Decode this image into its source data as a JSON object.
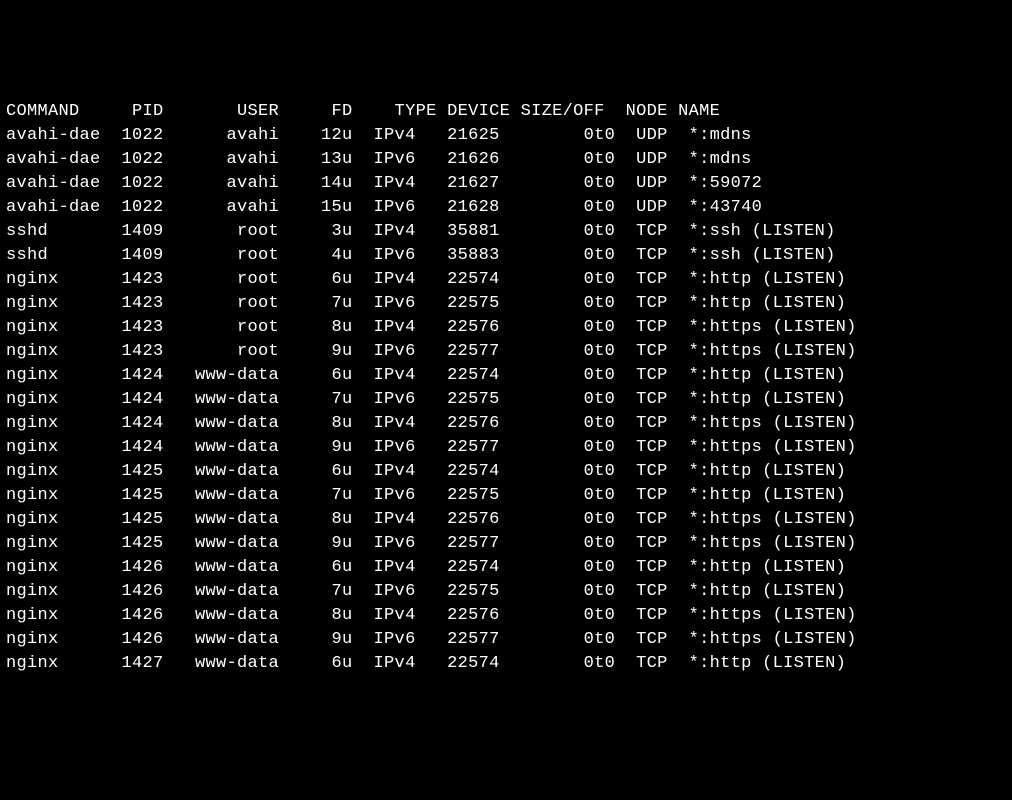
{
  "columns": {
    "command": "COMMAND",
    "pid": "PID",
    "user": "USER",
    "fd": "FD",
    "type": "TYPE",
    "device": "DEVICE",
    "sizeoff": "SIZE/OFF",
    "node": "NODE",
    "name": "NAME"
  },
  "rows": [
    {
      "command": "avahi-dae",
      "pid": "1022",
      "user": "avahi",
      "fd": "12u",
      "type": "IPv4",
      "device": "21625",
      "sizeoff": "0t0",
      "node": "UDP",
      "name": "*:mdns"
    },
    {
      "command": "avahi-dae",
      "pid": "1022",
      "user": "avahi",
      "fd": "13u",
      "type": "IPv6",
      "device": "21626",
      "sizeoff": "0t0",
      "node": "UDP",
      "name": "*:mdns"
    },
    {
      "command": "avahi-dae",
      "pid": "1022",
      "user": "avahi",
      "fd": "14u",
      "type": "IPv4",
      "device": "21627",
      "sizeoff": "0t0",
      "node": "UDP",
      "name": "*:59072"
    },
    {
      "command": "avahi-dae",
      "pid": "1022",
      "user": "avahi",
      "fd": "15u",
      "type": "IPv6",
      "device": "21628",
      "sizeoff": "0t0",
      "node": "UDP",
      "name": "*:43740"
    },
    {
      "command": "sshd",
      "pid": "1409",
      "user": "root",
      "fd": "3u",
      "type": "IPv4",
      "device": "35881",
      "sizeoff": "0t0",
      "node": "TCP",
      "name": "*:ssh (LISTEN)"
    },
    {
      "command": "sshd",
      "pid": "1409",
      "user": "root",
      "fd": "4u",
      "type": "IPv6",
      "device": "35883",
      "sizeoff": "0t0",
      "node": "TCP",
      "name": "*:ssh (LISTEN)"
    },
    {
      "command": "nginx",
      "pid": "1423",
      "user": "root",
      "fd": "6u",
      "type": "IPv4",
      "device": "22574",
      "sizeoff": "0t0",
      "node": "TCP",
      "name": "*:http (LISTEN)"
    },
    {
      "command": "nginx",
      "pid": "1423",
      "user": "root",
      "fd": "7u",
      "type": "IPv6",
      "device": "22575",
      "sizeoff": "0t0",
      "node": "TCP",
      "name": "*:http (LISTEN)"
    },
    {
      "command": "nginx",
      "pid": "1423",
      "user": "root",
      "fd": "8u",
      "type": "IPv4",
      "device": "22576",
      "sizeoff": "0t0",
      "node": "TCP",
      "name": "*:https (LISTEN)"
    },
    {
      "command": "nginx",
      "pid": "1423",
      "user": "root",
      "fd": "9u",
      "type": "IPv6",
      "device": "22577",
      "sizeoff": "0t0",
      "node": "TCP",
      "name": "*:https (LISTEN)"
    },
    {
      "command": "nginx",
      "pid": "1424",
      "user": "www-data",
      "fd": "6u",
      "type": "IPv4",
      "device": "22574",
      "sizeoff": "0t0",
      "node": "TCP",
      "name": "*:http (LISTEN)"
    },
    {
      "command": "nginx",
      "pid": "1424",
      "user": "www-data",
      "fd": "7u",
      "type": "IPv6",
      "device": "22575",
      "sizeoff": "0t0",
      "node": "TCP",
      "name": "*:http (LISTEN)"
    },
    {
      "command": "nginx",
      "pid": "1424",
      "user": "www-data",
      "fd": "8u",
      "type": "IPv4",
      "device": "22576",
      "sizeoff": "0t0",
      "node": "TCP",
      "name": "*:https (LISTEN)"
    },
    {
      "command": "nginx",
      "pid": "1424",
      "user": "www-data",
      "fd": "9u",
      "type": "IPv6",
      "device": "22577",
      "sizeoff": "0t0",
      "node": "TCP",
      "name": "*:https (LISTEN)"
    },
    {
      "command": "nginx",
      "pid": "1425",
      "user": "www-data",
      "fd": "6u",
      "type": "IPv4",
      "device": "22574",
      "sizeoff": "0t0",
      "node": "TCP",
      "name": "*:http (LISTEN)"
    },
    {
      "command": "nginx",
      "pid": "1425",
      "user": "www-data",
      "fd": "7u",
      "type": "IPv6",
      "device": "22575",
      "sizeoff": "0t0",
      "node": "TCP",
      "name": "*:http (LISTEN)"
    },
    {
      "command": "nginx",
      "pid": "1425",
      "user": "www-data",
      "fd": "8u",
      "type": "IPv4",
      "device": "22576",
      "sizeoff": "0t0",
      "node": "TCP",
      "name": "*:https (LISTEN)"
    },
    {
      "command": "nginx",
      "pid": "1425",
      "user": "www-data",
      "fd": "9u",
      "type": "IPv6",
      "device": "22577",
      "sizeoff": "0t0",
      "node": "TCP",
      "name": "*:https (LISTEN)"
    },
    {
      "command": "nginx",
      "pid": "1426",
      "user": "www-data",
      "fd": "6u",
      "type": "IPv4",
      "device": "22574",
      "sizeoff": "0t0",
      "node": "TCP",
      "name": "*:http (LISTEN)"
    },
    {
      "command": "nginx",
      "pid": "1426",
      "user": "www-data",
      "fd": "7u",
      "type": "IPv6",
      "device": "22575",
      "sizeoff": "0t0",
      "node": "TCP",
      "name": "*:http (LISTEN)"
    },
    {
      "command": "nginx",
      "pid": "1426",
      "user": "www-data",
      "fd": "8u",
      "type": "IPv4",
      "device": "22576",
      "sizeoff": "0t0",
      "node": "TCP",
      "name": "*:https (LISTEN)"
    },
    {
      "command": "nginx",
      "pid": "1426",
      "user": "www-data",
      "fd": "9u",
      "type": "IPv6",
      "device": "22577",
      "sizeoff": "0t0",
      "node": "TCP",
      "name": "*:https (LISTEN)"
    },
    {
      "command": "nginx",
      "pid": "1427",
      "user": "www-data",
      "fd": "6u",
      "type": "IPv4",
      "device": "22574",
      "sizeoff": "0t0",
      "node": "TCP",
      "name": "*:http (LISTEN)"
    }
  ]
}
